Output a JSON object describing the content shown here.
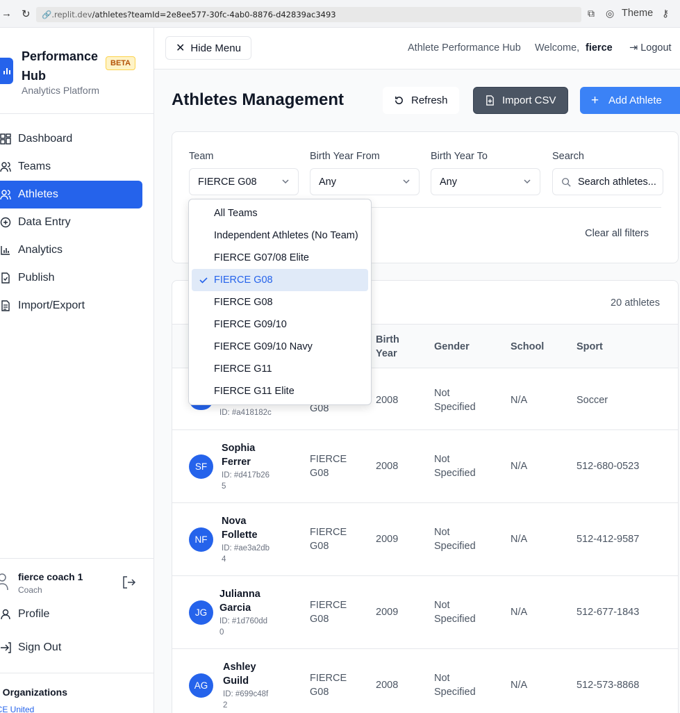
{
  "browser": {
    "url_host": ".replit.dev",
    "url_path": "/athletes?teamId=2e8ee577-30fc-4ab0-8876-d42839ac3493",
    "theme_label": "Theme"
  },
  "sidebar": {
    "brand_title": "Performance Hub",
    "beta": "BETA",
    "brand_sub": "Analytics Platform",
    "items": [
      {
        "label": "Dashboard",
        "icon": "dashboard-icon"
      },
      {
        "label": "Teams",
        "icon": "users-icon"
      },
      {
        "label": "Athletes",
        "icon": "user-group-icon"
      },
      {
        "label": "Data Entry",
        "icon": "plus-circle-icon"
      },
      {
        "label": "Analytics",
        "icon": "bar-chart-icon"
      },
      {
        "label": "Publish",
        "icon": "file-check-icon"
      },
      {
        "label": "Import/Export",
        "icon": "file-text-icon"
      }
    ],
    "active_item": "Athletes",
    "user": {
      "name": "fierce coach 1",
      "role": "Coach"
    },
    "profile": "Profile",
    "sign_out": "Sign Out",
    "orgs_title": "y Organizations",
    "org_item": "RCE United"
  },
  "header": {
    "hide_menu": "Hide Menu",
    "app_name": "Athlete Performance Hub",
    "welcome": "Welcome,",
    "username": "fierce",
    "logout": "Logout"
  },
  "page": {
    "title": "Athletes Management",
    "refresh": "Refresh",
    "import_csv": "Import CSV",
    "add_athlete": "Add Athlete"
  },
  "filters": {
    "team_label": "Team",
    "team_value": "FIERCE G08",
    "birth_from_label": "Birth Year From",
    "birth_from_value": "Any",
    "birth_to_label": "Birth Year To",
    "birth_to_value": "Any",
    "search_label": "Search",
    "search_placeholder": "Search athletes...",
    "clear_all": "Clear all filters"
  },
  "dropdown": {
    "options": [
      "All Teams",
      "Independent Athletes (No Team)",
      "FIERCE G07/08 Elite",
      "FIERCE G08",
      "FIERCE G08",
      "FIERCE G09/10",
      "FIERCE G09/10 Navy",
      "FIERCE G11",
      "FIERCE G11 Elite"
    ],
    "selected_index": 3
  },
  "table": {
    "count": "20 athletes",
    "headers": {
      "birth_year": "Birth Year",
      "gender": "Gender",
      "school": "School",
      "sport": "Sport"
    },
    "partial_row": {
      "id": "ID: #a418182c",
      "team_tail": "G08",
      "birth_year": "2008",
      "gender": "Not Specified",
      "school": "N/A",
      "sport": "Soccer"
    },
    "rows": [
      {
        "initials": "SF",
        "name": "Sophia Ferrer",
        "id": "ID: #d417b265",
        "team": "FIERCE G08",
        "birth_year": "2008",
        "gender": "Not Specified",
        "school": "N/A",
        "sport": "512-680-0523"
      },
      {
        "initials": "NF",
        "name": "Nova Follette",
        "id": "ID: #ae3a2db4",
        "team": "FIERCE G08",
        "birth_year": "2009",
        "gender": "Not Specified",
        "school": "N/A",
        "sport": "512-412-9587"
      },
      {
        "initials": "JG",
        "name": "Julianna Garcia",
        "id": "ID: #1d760dd0",
        "team": "FIERCE G08",
        "birth_year": "2009",
        "gender": "Not Specified",
        "school": "N/A",
        "sport": "512-677-1843"
      },
      {
        "initials": "AG",
        "name": "Ashley Guild",
        "id": "ID: #699c48f2",
        "team": "FIERCE G08",
        "birth_year": "2008",
        "gender": "Not Specified",
        "school": "N/A",
        "sport": "512-573-8868"
      }
    ]
  },
  "colors": {
    "primary": "#2563eb",
    "button_blue": "#3b82f6",
    "import_gray": "#4b5563",
    "beta_bg": "#fef3c7"
  }
}
